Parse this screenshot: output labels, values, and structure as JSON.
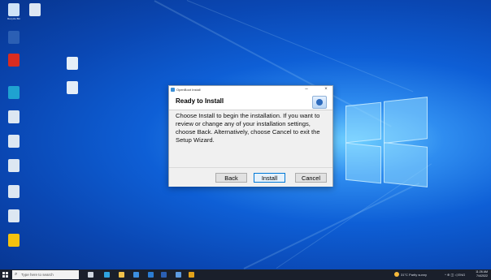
{
  "colors": {
    "accent": "#0078d7",
    "taskbar": "#1a1f2b",
    "desktop": "#0e5fd6"
  },
  "desktop": {
    "icons": [
      {
        "name": "recycle-bin-icon",
        "label": "Recycle Bin",
        "color": "#cfe3f7"
      },
      {
        "name": "file-icon",
        "label": "",
        "color": "#dde7f2"
      },
      {
        "name": "word-doc-icon",
        "label": "",
        "color": "#2b5fb4"
      },
      {
        "name": "pdf-icon",
        "label": "",
        "color": "#d82c20"
      },
      {
        "name": "edge-icon",
        "label": "",
        "color": "#1fa2d1"
      },
      {
        "name": "file-icon",
        "label": "",
        "color": "#dde7f2"
      },
      {
        "name": "file-icon",
        "label": "",
        "color": "#dde7f2"
      },
      {
        "name": "file-icon",
        "label": "",
        "color": "#dde7f2"
      },
      {
        "name": "file-icon",
        "label": "",
        "color": "#dde7f2"
      },
      {
        "name": "file-icon",
        "label": "",
        "color": "#dde7f2"
      },
      {
        "name": "chrome-icon",
        "label": "",
        "color": "#f4c20d"
      },
      {
        "name": "file-icon",
        "label": "",
        "color": "#e4eef8"
      },
      {
        "name": "file-icon",
        "label": "",
        "color": "#e4eef8"
      },
      {
        "name": "file-icon",
        "label": "",
        "color": "#e4eef8"
      }
    ]
  },
  "dialog": {
    "window_title": "OpenBoot Install",
    "heading": "Ready to Install",
    "message": "Choose Install to begin the installation. If you want to review or change any of your installation settings, choose Back. Alternatively, choose Cancel to exit the Setup Wizard.",
    "buttons": {
      "back": "Back",
      "install": "Install",
      "cancel": "Cancel"
    },
    "minimize_glyph": "–",
    "close_glyph": "×"
  },
  "taskbar": {
    "search_placeholder": "Type here to search",
    "search_glyph": "⌕",
    "weather": "31°C  Partly sunny",
    "tray": "^ ⊕ ◫ ◁ ENG",
    "clock_time": "11:26 AM",
    "clock_date": "7/4/2022",
    "apps": [
      {
        "name": "task-view-icon",
        "color": "#cfd6df"
      },
      {
        "name": "edge-icon",
        "color": "#2fa4e0"
      },
      {
        "name": "file-explorer-icon",
        "color": "#f0c14b"
      },
      {
        "name": "store-icon",
        "color": "#3c8fe0"
      },
      {
        "name": "mail-icon",
        "color": "#2b7cd3"
      },
      {
        "name": "word-icon",
        "color": "#2b5fb4"
      },
      {
        "name": "app-icon",
        "color": "#5d9be0"
      },
      {
        "name": "chrome-icon",
        "color": "#e3a21a"
      }
    ]
  }
}
